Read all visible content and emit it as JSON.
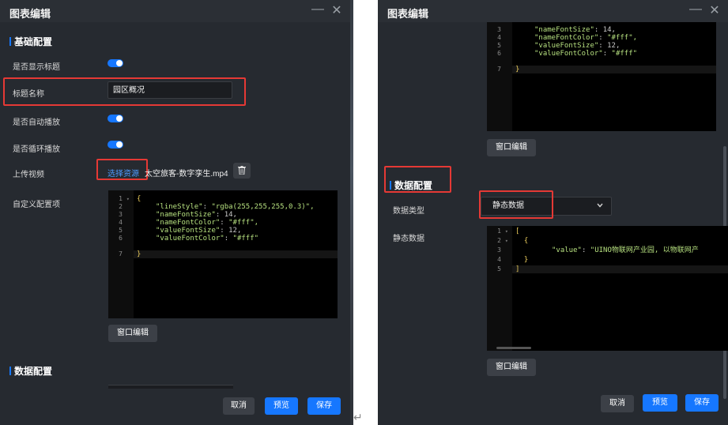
{
  "left": {
    "title": "图表编辑",
    "min_icon": "—",
    "close_icon": "✕",
    "section_basic": "基础配置",
    "show_title_label": "是否显示标题",
    "title_name_label": "标题名称",
    "title_name_value": "园区概况",
    "autoplay_label": "是否自动播放",
    "loop_label": "是否循环播放",
    "upload_video_label": "上传视频",
    "select_resource": "选择资源",
    "file_name": "太空旅客-数字孪生.mp4",
    "custom_config_label": "自定义配置项",
    "code_lines": [
      {
        "n": "1",
        "fold": "▾",
        "text": "{"
      },
      {
        "n": "2",
        "fold": "",
        "key": "\"lineStyle\"",
        "val": "\"rgba(255,255,255,0.3)\","
      },
      {
        "n": "3",
        "fold": "",
        "key": "\"nameFontSize\"",
        "val": "14,"
      },
      {
        "n": "4",
        "fold": "",
        "key": "\"nameFontColor\"",
        "val": "\"#fff\","
      },
      {
        "n": "5",
        "fold": "",
        "key": "\"valueFontSize\"",
        "val": "12,"
      },
      {
        "n": "6",
        "fold": "",
        "key": "\"valueFontColor\"",
        "val": "\"#fff\""
      },
      {
        "n": "7",
        "fold": "",
        "text": "}"
      }
    ],
    "window_edit": "窗口编辑",
    "section_data": "数据配置",
    "cancel": "取消",
    "preview": "预览",
    "save": "保存"
  },
  "right": {
    "title": "图表编辑",
    "min_icon": "—",
    "close_icon": "✕",
    "code_lines_top": [
      {
        "n": "3",
        "key": "\"nameFontSize\"",
        "val": "14,"
      },
      {
        "n": "4",
        "key": "\"nameFontColor\"",
        "val": "\"#fff\","
      },
      {
        "n": "5",
        "key": "\"valueFontSize\"",
        "val": "12,"
      },
      {
        "n": "6",
        "key": "\"valueFontColor\"",
        "val": "\"#fff\""
      },
      {
        "n": "7",
        "text": "}"
      }
    ],
    "window_edit_1": "窗口编辑",
    "section_data": "数据配置",
    "data_type_label": "数据类型",
    "data_type_value": "静态数据",
    "static_data_label": "静态数据",
    "code_lines_data": [
      {
        "n": "1",
        "fold": "▾",
        "text": "["
      },
      {
        "n": "2",
        "fold": "▾",
        "text": "  {"
      },
      {
        "n": "3",
        "fold": "",
        "key": "\"value\"",
        "val": "\"UINO物联网产业园, 以物联网产"
      },
      {
        "n": "4",
        "fold": "",
        "text": "  }"
      },
      {
        "n": "5",
        "fold": "",
        "text": "]"
      }
    ],
    "window_edit_2": "窗口编辑",
    "cancel": "取消",
    "preview": "预览",
    "save": "保存"
  },
  "colors": {
    "panel_bg": "#262a30",
    "accent": "#1677ff",
    "highlight_box": "#e53935"
  },
  "return_glyph": "↵"
}
